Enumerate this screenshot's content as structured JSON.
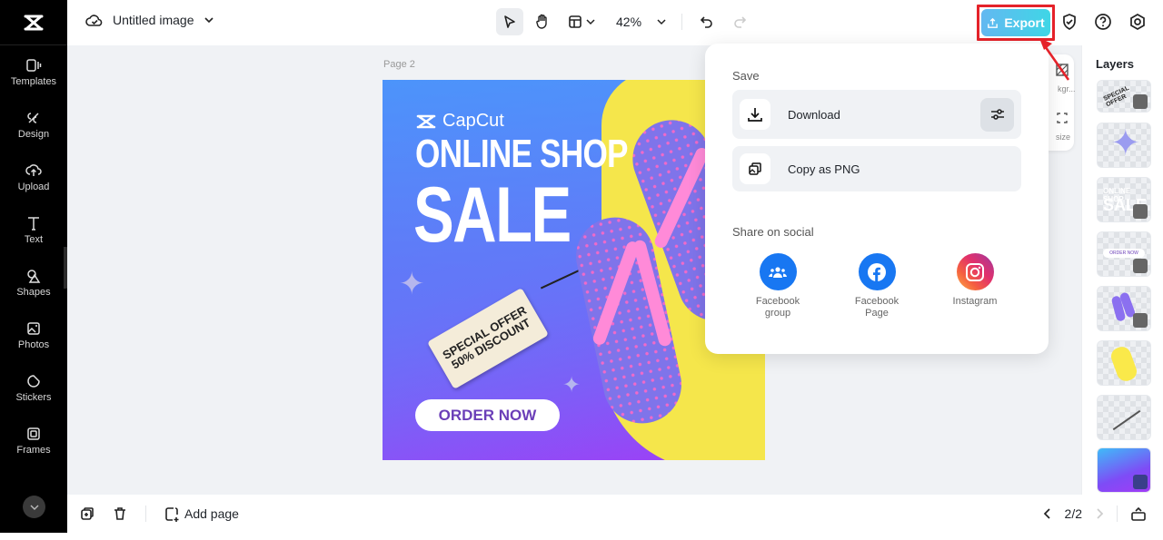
{
  "app": {
    "name": "CapCut"
  },
  "header": {
    "doc_title": "Untitled image",
    "zoom_level": "42%",
    "export_label": "Export"
  },
  "sidebar": {
    "items": [
      {
        "label": "Templates",
        "icon": "templates-icon"
      },
      {
        "label": "Design",
        "icon": "design-icon"
      },
      {
        "label": "Upload",
        "icon": "upload-icon"
      },
      {
        "label": "Text",
        "icon": "text-icon"
      },
      {
        "label": "Shapes",
        "icon": "shapes-icon"
      },
      {
        "label": "Photos",
        "icon": "photos-icon"
      },
      {
        "label": "Stickers",
        "icon": "stickers-icon"
      },
      {
        "label": "Frames",
        "icon": "frames-icon"
      }
    ]
  },
  "canvas": {
    "page_label": "Page 2",
    "design": {
      "brand": "CapCut",
      "headline": "ONLINE SHOP",
      "headline2": "SALE",
      "tag_line1": "SPECIAL OFFER",
      "tag_line2": "50% DISCOUNT",
      "cta": "ORDER NOW"
    },
    "mini_toolbar": {
      "bg_label": "kgr...",
      "resize_label": "size"
    }
  },
  "export_popup": {
    "save_title": "Save",
    "download_label": "Download",
    "copy_label": "Copy as PNG",
    "share_title": "Share on social",
    "social": [
      {
        "line1": "Facebook",
        "line2": "group",
        "color": "#1877f2"
      },
      {
        "line1": "Facebook",
        "line2": "Page",
        "color": "#1877f2"
      },
      {
        "line1": "Instagram",
        "line2": "",
        "color": "#e1306c"
      }
    ]
  },
  "layers": {
    "title": "Layers",
    "items": [
      "Special offer tag",
      "Sparkle",
      "Online shop sale text",
      "Order now button",
      "Flip flops",
      "Yellow blob",
      "Tag string",
      "Background gradient"
    ]
  },
  "footer": {
    "add_page_label": "Add page",
    "page_indicator": "2/2"
  },
  "colors": {
    "accent": "#3fd6e6",
    "highlight_box": "#e5222a"
  }
}
